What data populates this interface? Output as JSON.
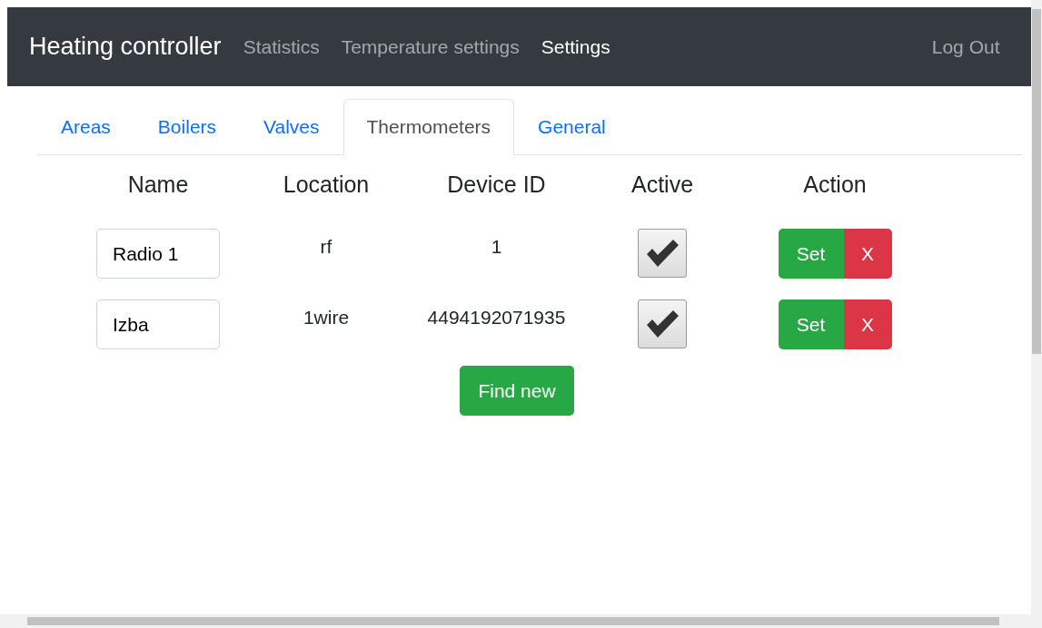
{
  "navbar": {
    "brand": "Heating controller",
    "links": [
      {
        "label": "Statistics",
        "selected": false
      },
      {
        "label": "Temperature settings",
        "selected": false
      },
      {
        "label": "Settings",
        "selected": true
      }
    ],
    "logout": "Log Out"
  },
  "tabs": [
    {
      "label": "Areas",
      "selected": false
    },
    {
      "label": "Boilers",
      "selected": false
    },
    {
      "label": "Valves",
      "selected": false
    },
    {
      "label": "Thermometers",
      "selected": true
    },
    {
      "label": "General",
      "selected": false
    }
  ],
  "table": {
    "columns": [
      "Name",
      "Location",
      "Device ID",
      "Active",
      "Action"
    ],
    "rows": [
      {
        "name": "Radio 1",
        "location": "rf",
        "device_id": "1",
        "active": true,
        "set": "Set",
        "delete": "X"
      },
      {
        "name": "Izba",
        "location": "1wire",
        "device_id": "4494192071935",
        "active": true,
        "set": "Set",
        "delete": "X"
      }
    ]
  },
  "find_button": "Find new"
}
